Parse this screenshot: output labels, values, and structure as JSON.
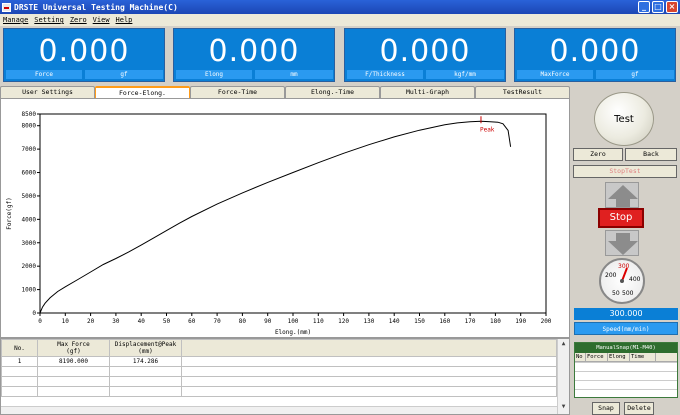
{
  "window": {
    "title": "DRSTE Universal Testing Machine(C)",
    "controls": [
      "_",
      "□",
      "×"
    ]
  },
  "menu": [
    "Manage",
    "Setting",
    "Zero",
    "View",
    "Help"
  ],
  "readouts": [
    {
      "value": "0.000",
      "label": "Force",
      "unit": "gf"
    },
    {
      "value": "0.000",
      "label": "Elong",
      "unit": "mm"
    },
    {
      "value": "0.000",
      "label": "F/Thickness",
      "unit": "kgf/mm"
    },
    {
      "value": "0.000",
      "label": "MaxForce",
      "unit": "gf"
    }
  ],
  "tabs": [
    "User Settings",
    "Force-Elong.",
    "Force-Time",
    "Elong.-Time",
    "Multi-Graph",
    "TestResult"
  ],
  "active_tab": 1,
  "chart_data": {
    "type": "line",
    "xlabel": "Elong.(mm)",
    "ylabel": "Force(gf)",
    "xlim": [
      0,
      200
    ],
    "ylim": [
      0,
      8500
    ],
    "xticks": [
      "0",
      "10",
      "20",
      "30",
      "40",
      "50",
      "60",
      "70",
      "80",
      "90",
      "100",
      "110",
      "120",
      "130",
      "140",
      "150",
      "160",
      "170",
      "180",
      "190",
      "200"
    ],
    "yticks": [
      "0",
      "1000",
      "2000",
      "3000",
      "4000",
      "5000",
      "6000",
      "7000",
      "8000",
      "8500"
    ],
    "grid": false,
    "series": [
      {
        "color": "#000000",
        "x": [
          0,
          1,
          2,
          4,
          7,
          10,
          15,
          20,
          25,
          30,
          35,
          40,
          45,
          50,
          55,
          60,
          70,
          80,
          90,
          100,
          110,
          120,
          130,
          140,
          150,
          160,
          165,
          170,
          174.3,
          178,
          181,
          183,
          185,
          186
        ],
        "y": [
          0,
          250,
          420,
          650,
          920,
          1120,
          1430,
          1750,
          2070,
          2330,
          2600,
          2900,
          3210,
          3520,
          3830,
          4120,
          4650,
          5130,
          5580,
          6000,
          6420,
          6820,
          7190,
          7520,
          7810,
          8040,
          8120,
          8170,
          8190,
          8170,
          8150,
          8080,
          7800,
          7100
        ]
      }
    ],
    "annotations": [
      {
        "text": "Peak",
        "x": 174.3,
        "y": 8190
      }
    ]
  },
  "results_table": {
    "headers": [
      "No.",
      "Max Force\n(gf)",
      "Displacement@Peak\n(mm)"
    ],
    "rows": [
      [
        "1",
        "8190.000",
        "174.286"
      ]
    ]
  },
  "controls": {
    "test_label": "Test",
    "zero_label": "Zero",
    "back_label": "Back",
    "stoptest_label": "StopTest",
    "stop_label": "Stop",
    "speed_value": "300.000",
    "speed_label": "Speed(mm/min)",
    "gauge_labels": [
      "200",
      "300",
      "400",
      "50",
      "500"
    ]
  },
  "snap_panel": {
    "title": "ManualSnap(M1-M40)",
    "headers": [
      "No",
      "Force",
      "Elong",
      "Time"
    ],
    "snap_label": "Snap",
    "delete_label": "Delete"
  },
  "colors": {
    "readout_bg": "#0a7fd6",
    "stop": "#e02020",
    "active_tab": "#ff9c1a"
  }
}
